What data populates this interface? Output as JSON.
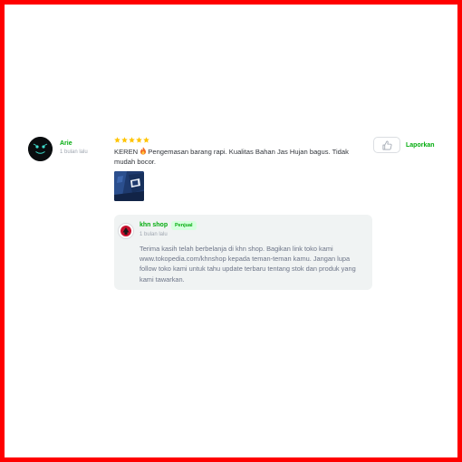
{
  "reviewer": {
    "name": "Arie",
    "time_ago": "1 bulan lalu",
    "avatar_icon": "dark-avatar-icon"
  },
  "review": {
    "rating": 5,
    "star_color": "#ffc400",
    "emoji_icon": "fire-icon",
    "text_prefix": "KEREN",
    "text_body": "Pengemasan barang rapi. Kualitas Bahan Jas Hujan bagus. Tidak mudah bocor.",
    "photo_icon": "review-photo-thumbnail"
  },
  "actions": {
    "like_icon": "thumbs-up-icon",
    "report_label": "Laporkan"
  },
  "reply": {
    "seller_name": "khn shop",
    "seller_badge": "Penjual",
    "time_ago": "1 bulan lalu",
    "text": "Terima kasih telah berbelanja di khn shop. Bagikan link toko kami www.tokopedia.com/khnshop kepada teman-teman kamu. Jangan lupa follow toko kami untuk tahu update terbaru tentang stok dan produk yang kami tawarkan."
  },
  "colors": {
    "accent": "#03ac0e",
    "frame_border": "#ff0000",
    "reply_background": "#f0f3f3"
  }
}
